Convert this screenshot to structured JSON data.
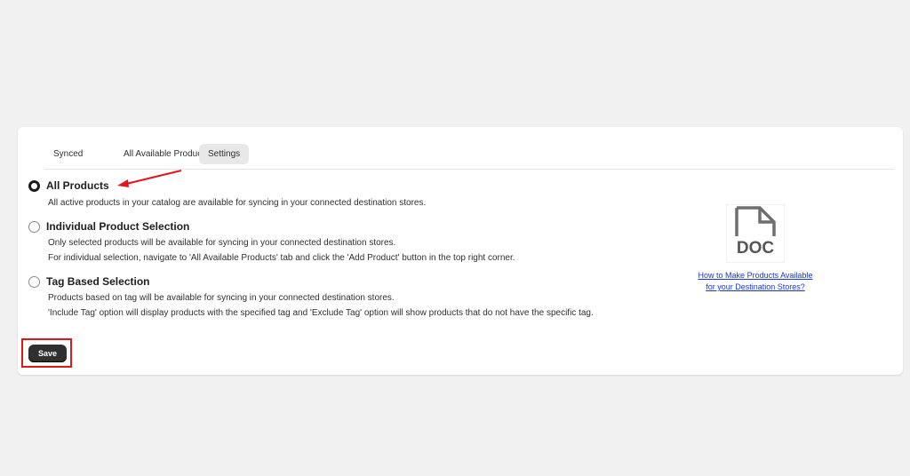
{
  "tabs": [
    {
      "label": "Synced"
    },
    {
      "label": "All Available Products"
    },
    {
      "label": "Settings"
    }
  ],
  "options": [
    {
      "label": "All Products",
      "checked": true,
      "desc": [
        "All active products in your catalog are available for syncing in your connected destination stores."
      ]
    },
    {
      "label": "Individual Product Selection",
      "checked": false,
      "desc": [
        "Only selected products will be available for syncing in your connected destination stores.",
        "For individual selection, navigate to 'All Available Products' tab and click the 'Add Product' button in the top right corner."
      ]
    },
    {
      "label": "Tag Based Selection",
      "checked": false,
      "desc": [
        "Products based on tag will be available for syncing in your connected destination stores.",
        "'Include Tag' option will display products with the specified tag and 'Exclude Tag' option will show products that do not have the specific tag."
      ]
    }
  ],
  "doc": {
    "icon_text": "DOC",
    "icon": "document-icon",
    "link_line1": "How to Make Products Available",
    "link_line2": "for your Destination Stores?"
  },
  "save_label": "Save",
  "colors": {
    "annotation_red": "#e0161d",
    "link": "#1a35d6",
    "button_dark": "#303030"
  }
}
